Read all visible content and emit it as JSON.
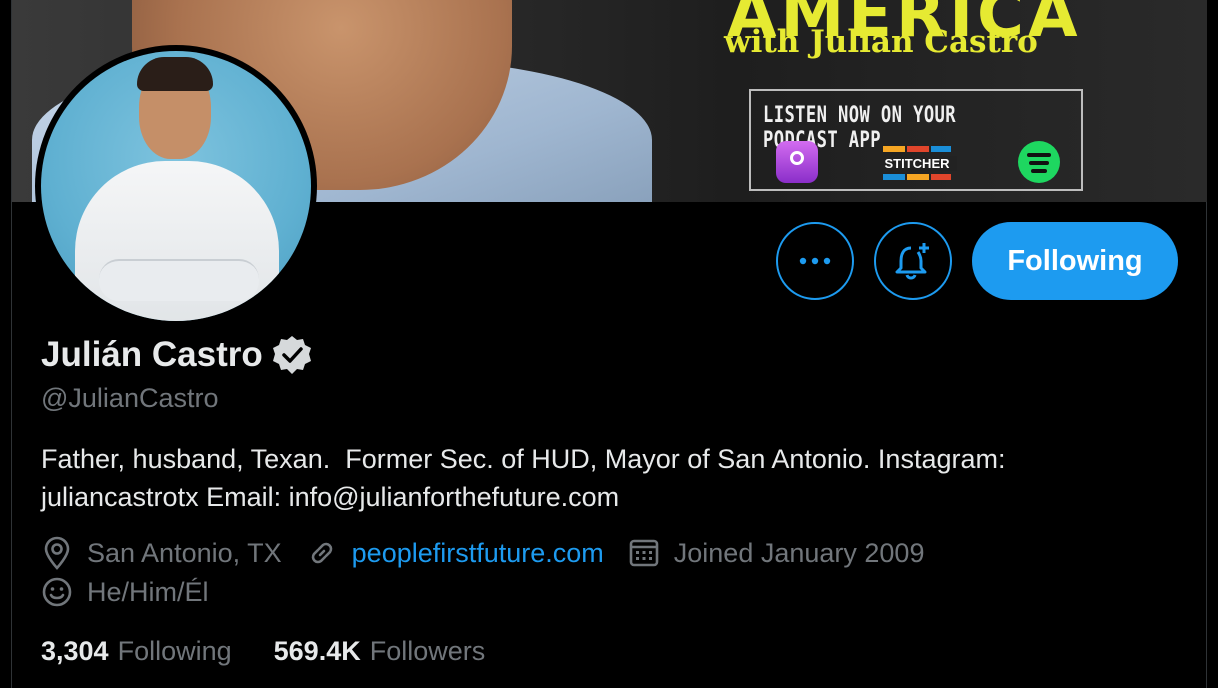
{
  "banner": {
    "headline_partial": "AMERICA",
    "subtitle": "with Julián Castro",
    "cta": "LISTEN NOW ON YOUR PODCAST APP",
    "stitcher_label": "STITCHER"
  },
  "actions": {
    "more_icon": "more-dots-icon",
    "bell_icon": "bell-plus-icon",
    "following_label": "Following"
  },
  "profile": {
    "name": "Julián Castro",
    "handle": "@JulianCastro",
    "bio_line1": "Father, husband, Texan.  Former Sec. of HUD, Mayor of San Antonio. Instagram:",
    "bio_line2": "juliancastrotx Email: info@julianforthefuture.com",
    "location": "San Antonio, TX",
    "website": "peoplefirstfuture.com",
    "joined": "Joined January 2009",
    "pronouns": "He/Him/Él"
  },
  "stats": {
    "following_count": "3,304",
    "following_label": "Following",
    "followers_count": "569.4K",
    "followers_label": "Followers"
  },
  "colors": {
    "accent": "#1d9bf0",
    "muted": "#71767b",
    "text": "#e7e9ea",
    "banner_yellow": "#e6ea32"
  }
}
